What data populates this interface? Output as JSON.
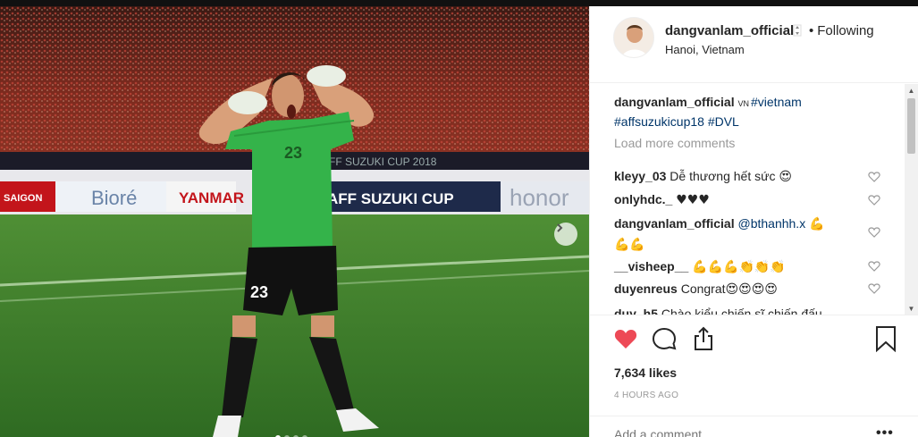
{
  "post": {
    "username": "dangvanlam_official",
    "follow_status": "Following",
    "bullet": "•",
    "location": "Hanoi, Vietnam",
    "caption": {
      "username": "dangvanlam_official",
      "flag": "VN",
      "tags_line1": "#vietnam",
      "tags_line2": "#affsuzukicup18 #DVL"
    },
    "load_more": "Load more comments",
    "comments": [
      {
        "user": "kleyy_03",
        "text": "Dễ thương hết sức",
        "emoji": "😍"
      },
      {
        "user": "onlyhdc._",
        "text": "",
        "emoji": "♥♥♥"
      },
      {
        "user": "dangvanlam_official",
        "text": "@bthanhh.x",
        "emoji": "💪",
        "emoji2": "💪💪"
      },
      {
        "user": "__visheep__",
        "text": "",
        "emoji": "💪💪💪👏👏👏"
      },
      {
        "user": "duyenreus",
        "text": "Congrat",
        "emoji": "😍😍😍😍"
      },
      {
        "user": "duy_h5",
        "text": "Chào kiểu chiến sĩ chiến đấu",
        "emoji": ""
      }
    ],
    "likes": "7,634 likes",
    "time": "4 HOURS AGO",
    "add_comment_placeholder": "Add a comment...",
    "more_label": "•••"
  },
  "photo": {
    "jersey_number": "23",
    "banner_texts": [
      "SAIGON",
      "Bioré",
      "YANMAR",
      "AFF SUZUKI CUP",
      "honor"
    ],
    "banner_top_text": "AFF SUZUKI CUP 2018",
    "carousel_count": 4,
    "carousel_active": 0
  },
  "colors": {
    "accent_like": "#ed4956",
    "link": "#003569",
    "muted": "#999999"
  },
  "icons": [
    "verified-icon",
    "chevron-right-icon",
    "heart-icon",
    "comment-icon",
    "share-icon",
    "bookmark-icon",
    "heart-outline-icon",
    "more-icon"
  ]
}
